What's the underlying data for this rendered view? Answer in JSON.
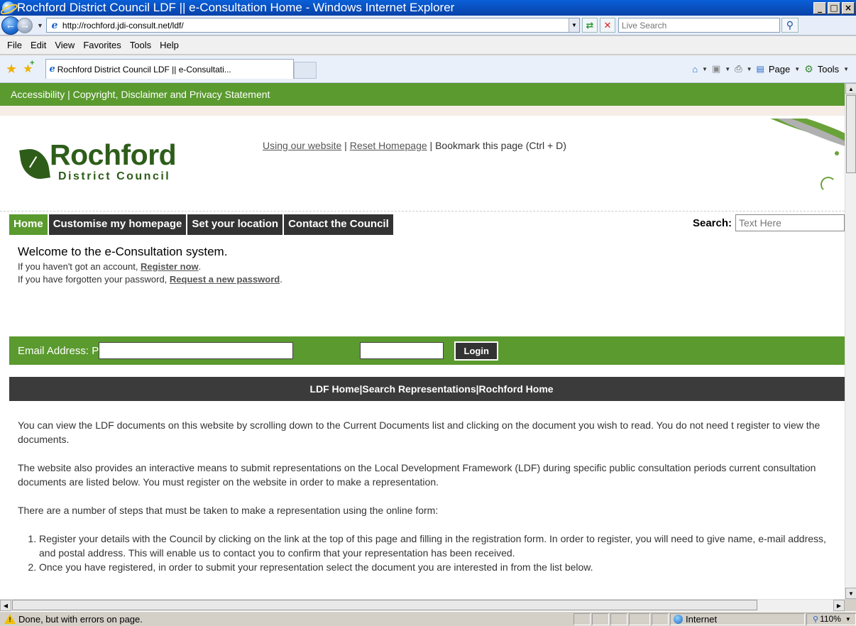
{
  "window": {
    "title": "Rochford District Council LDF || e-Consultation Home - Windows Internet Explorer",
    "min_label": "_",
    "max_label": "□",
    "close_label": "×"
  },
  "address": {
    "url": "http://rochford.jdi-consult.net/ldf/",
    "search_placeholder": "Live Search"
  },
  "menu": [
    "File",
    "Edit",
    "View",
    "Favorites",
    "Tools",
    "Help"
  ],
  "tab": {
    "title": "Rochford District Council LDF || e-Consultati..."
  },
  "commandbar": {
    "page_label": "Page",
    "tools_label": "Tools"
  },
  "site": {
    "top_links": "Accessibility | Copyright, Disclaimer and Privacy Statement",
    "logo_name": "Rochford",
    "logo_sub": "District Council",
    "util_link_1": "Using our website",
    "util_sep_1": " | ",
    "util_link_2": "Reset Homepage",
    "util_tail": " | Bookmark this page (Ctrl + D)",
    "nav": [
      "Home",
      "Customise my homepage",
      "Set your location",
      "Contact the Council"
    ],
    "search_label": "Search:",
    "search_value": "Text Here",
    "welcome_title": "Welcome to the e-Consultation system.",
    "welcome_line1_pre": "If you haven't got an account, ",
    "welcome_line1_link": "Register now",
    "welcome_line1_post": ".",
    "welcome_line2_pre": "If you have forgotten your password, ",
    "welcome_line2_link": "Request a new password",
    "welcome_line2_post": ".",
    "login_label": "Email Address: P",
    "login_button": "Login",
    "ldf_bar": "LDF Home|Search Representations|Rochford Home",
    "para1": "You can view the LDF documents on this website by scrolling down to the Current Documents list and clicking on the document you wish to read. You do not need t register to view the documents.",
    "para2": "The website also provides an interactive means to submit representations on the Local Development Framework (LDF) during specific public consultation periods current consultation documents are listed below. You must register on the website in order to make a representation.",
    "para3": "There are a number of steps that must be taken to make a representation using the online form:",
    "steps": [
      "Register your details with the Council by clicking on the link at the top of this page and filling in the registration form. In order to register, you will need to give name, e-mail address, and postal address. This will enable us to contact you to confirm that your representation has been received.",
      "Once you have registered, in order to submit your representation select the document you are interested in from the list below."
    ]
  },
  "status": {
    "text": "Done, but with errors on page.",
    "zone": "Internet",
    "zoom": "110%"
  }
}
